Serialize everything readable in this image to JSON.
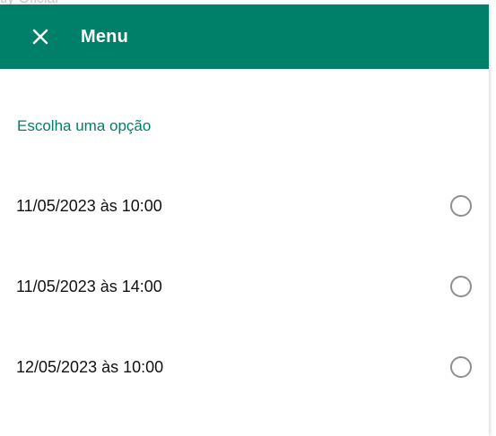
{
  "colors": {
    "header_background": "#008069",
    "accent_text": "#008069",
    "radio_border": "#8f8f8f"
  },
  "background": {
    "partial_text": "tiy Oficial"
  },
  "drawer": {
    "close_icon": "close-icon",
    "title": "Menu"
  },
  "section": {
    "title": "Escolha uma opção"
  },
  "options": [
    {
      "label": "11/05/2023 às 10:00",
      "selected": false
    },
    {
      "label": "11/05/2023 às 14:00",
      "selected": false
    },
    {
      "label": "12/05/2023 às 10:00",
      "selected": false
    }
  ]
}
